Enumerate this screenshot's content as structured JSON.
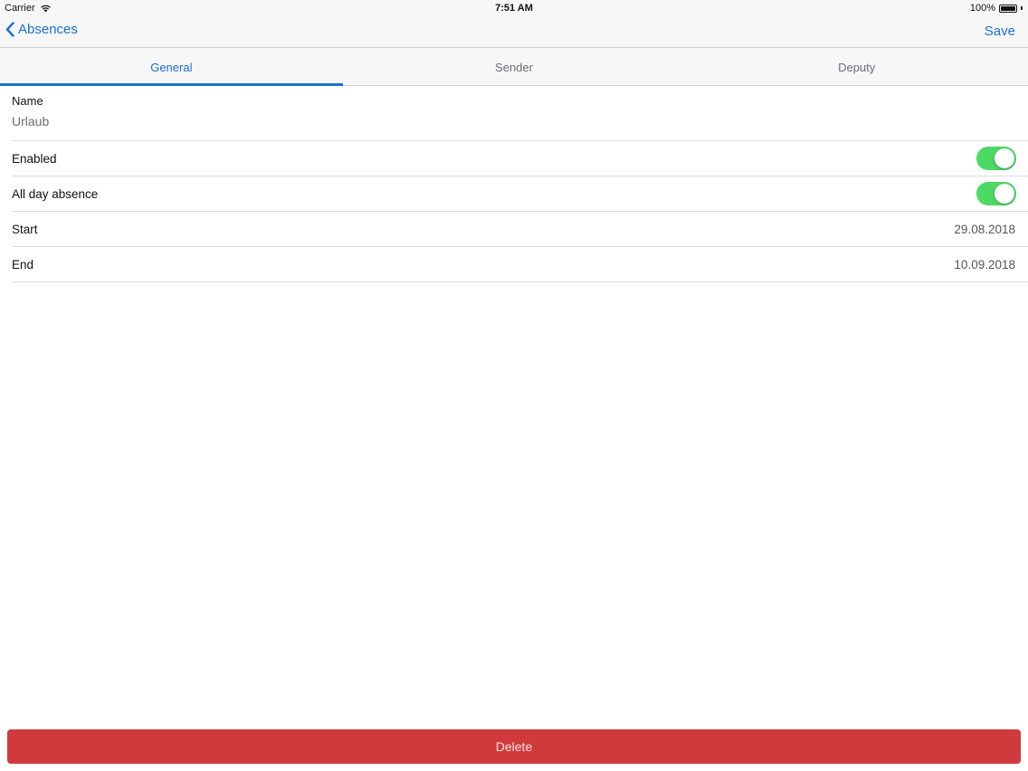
{
  "status_bar": {
    "carrier": "Carrier",
    "time": "7:51 AM",
    "battery": "100%"
  },
  "navbar": {
    "back_label": "Absences",
    "save_label": "Save"
  },
  "tabs": [
    {
      "label": "General",
      "active": true
    },
    {
      "label": "Sender",
      "active": false
    },
    {
      "label": "Deputy",
      "active": false
    }
  ],
  "form": {
    "name_label": "Name",
    "name_value": "Urlaub",
    "enabled_label": "Enabled",
    "enabled_on": true,
    "all_day_label": "All day absence",
    "all_day_on": true,
    "start_label": "Start",
    "start_value": "29.08.2018",
    "end_label": "End",
    "end_value": "10.09.2018"
  },
  "delete_label": "Delete",
  "colors": {
    "accent": "#1a6fd4",
    "toggle_on": "#4cd964",
    "delete": "#d13a3d"
  }
}
